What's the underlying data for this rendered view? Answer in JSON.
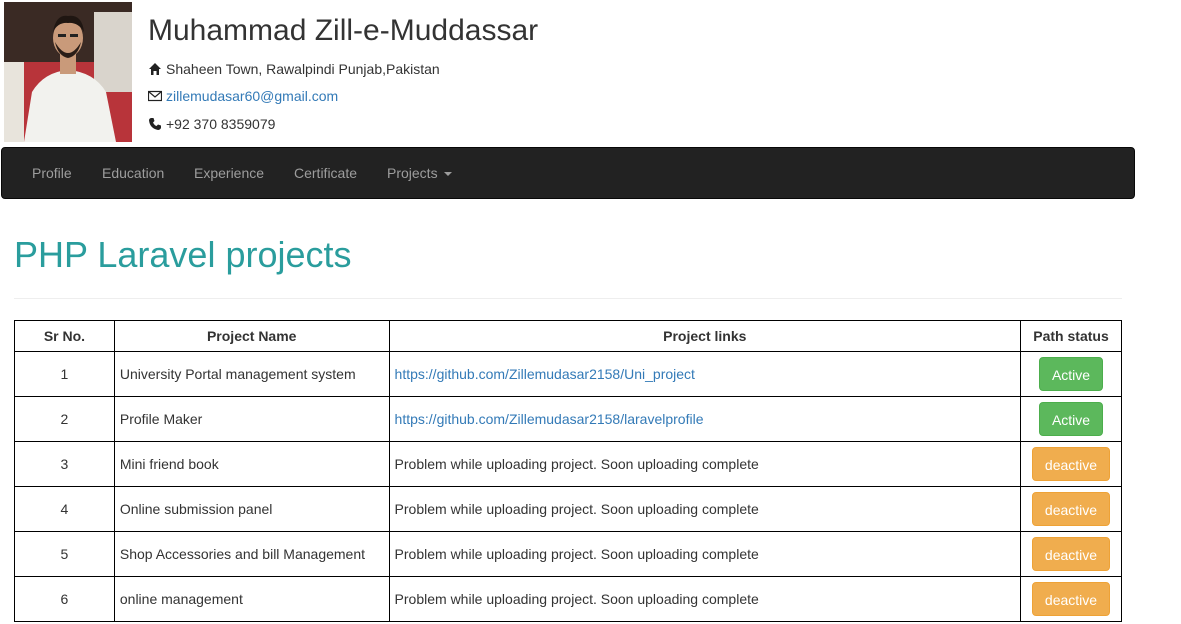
{
  "profile": {
    "name": "Muhammad Zill-e-Muddassar",
    "address": "Shaheen Town, Rawalpindi Punjab,Pakistan",
    "email": "zillemudasar60@gmail.com",
    "phone": "+92 370 8359079",
    "address_icon": "home-icon",
    "email_icon": "envelope-icon",
    "phone_icon": "phone-icon"
  },
  "nav": {
    "items": [
      "Profile",
      "Education",
      "Experience",
      "Certificate",
      "Projects"
    ]
  },
  "page": {
    "heading": "PHP Laravel projects",
    "heading_color": "#2a9d9d"
  },
  "table": {
    "headers": [
      "Sr No.",
      "Project Name",
      "Project links",
      "Path status"
    ],
    "rows": [
      {
        "sr": "1",
        "name": "University Portal management system",
        "link": "https://github.com/Zillemudasar2158/Uni_project",
        "status": "Active"
      },
      {
        "sr": "2",
        "name": "Profile Maker",
        "link": "https://github.com/Zillemudasar2158/laravelprofile",
        "status": "Active"
      },
      {
        "sr": "3",
        "name": "Mini friend book",
        "link": "Problem while uploading project. Soon uploading complete",
        "status": "deactive"
      },
      {
        "sr": "4",
        "name": "Online submission panel",
        "link": "Problem while uploading project. Soon uploading complete",
        "status": "deactive"
      },
      {
        "sr": "5",
        "name": "Shop Accessories and bill Management",
        "link": "Problem while uploading project. Soon uploading complete",
        "status": "deactive"
      },
      {
        "sr": "6",
        "name": "online management",
        "link": "Problem while uploading project. Soon uploading complete",
        "status": "deactive"
      }
    ]
  },
  "colors": {
    "active": "#5cb85c",
    "deactive": "#f0ad4e",
    "navbar": "#222222",
    "link": "#337ab7"
  }
}
